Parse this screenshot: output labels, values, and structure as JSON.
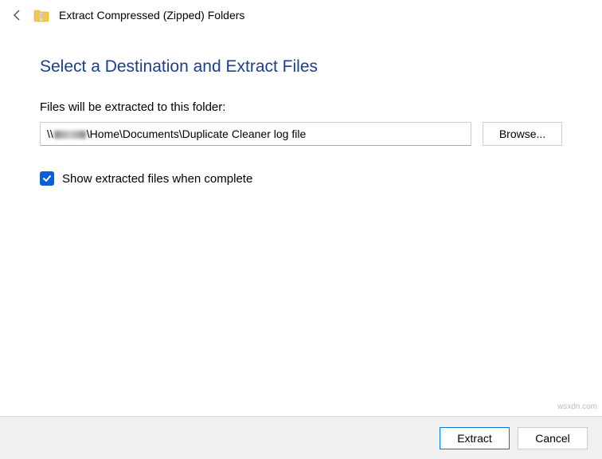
{
  "titlebar": {
    "title": "Extract Compressed (Zipped) Folders"
  },
  "heading": "Select a Destination and Extract Files",
  "instruction": "Files will be extracted to this folder:",
  "path": {
    "prefix": "\\\\",
    "suffix": "\\Home\\Documents\\Duplicate Cleaner log file"
  },
  "browse_label": "Browse...",
  "checkbox": {
    "checked": true,
    "label": "Show extracted files when complete"
  },
  "footer": {
    "extract": "Extract",
    "cancel": "Cancel"
  },
  "watermark": "wsxdn.com"
}
